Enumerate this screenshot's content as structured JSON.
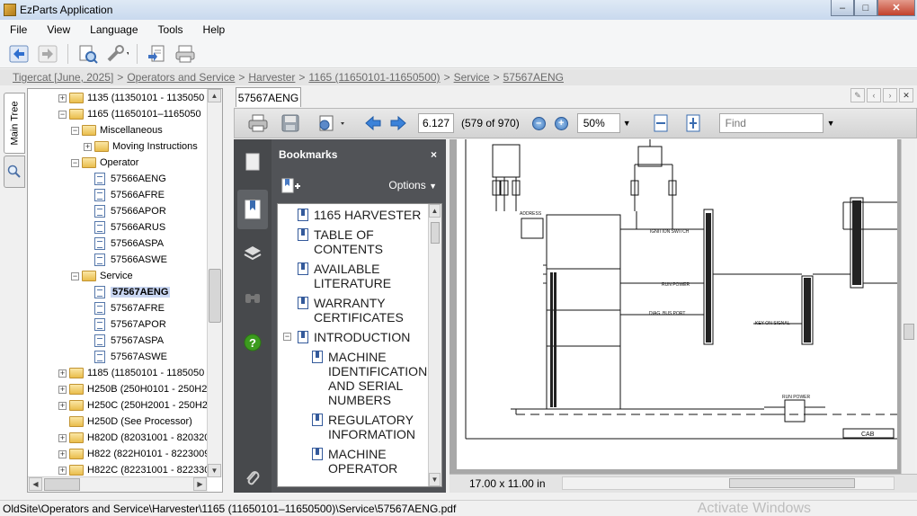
{
  "window": {
    "title": "EzParts Application"
  },
  "menu": [
    "File",
    "View",
    "Language",
    "Tools",
    "Help"
  ],
  "breadcrumb": [
    "Tigercat [June, 2025]",
    "Operators and Service",
    "Harvester",
    "1165 (11650101-11650500)",
    "Service",
    "57567AENG"
  ],
  "side_tabs": {
    "main_tree": "Main Tree"
  },
  "tree": {
    "items": [
      {
        "label": "1135 (11350101 - 1135050",
        "type": "folder",
        "state": "expand"
      },
      {
        "label": "1165 (11650101–1165050",
        "type": "folder",
        "state": "collapse"
      },
      {
        "label": "Miscellaneous",
        "type": "folder",
        "state": "collapse"
      },
      {
        "label": "Moving Instructions",
        "type": "folder",
        "state": "expand"
      },
      {
        "label": "Operator",
        "type": "folder",
        "state": "collapse"
      },
      {
        "label": "57566AENG",
        "type": "doc"
      },
      {
        "label": "57566AFRE",
        "type": "doc"
      },
      {
        "label": "57566APOR",
        "type": "doc"
      },
      {
        "label": "57566ARUS",
        "type": "doc"
      },
      {
        "label": "57566ASPA",
        "type": "doc"
      },
      {
        "label": "57566ASWE",
        "type": "doc"
      },
      {
        "label": "Service",
        "type": "folder",
        "state": "collapse"
      },
      {
        "label": "57567AENG",
        "type": "doc",
        "selected": true
      },
      {
        "label": "57567AFRE",
        "type": "doc"
      },
      {
        "label": "57567APOR",
        "type": "doc"
      },
      {
        "label": "57567ASPA",
        "type": "doc"
      },
      {
        "label": "57567ASWE",
        "type": "doc"
      },
      {
        "label": "1185 (11850101 - 1185050",
        "type": "folder",
        "state": "expand"
      },
      {
        "label": "H250B (250H0101 - 250H20",
        "type": "folder",
        "state": "expand"
      },
      {
        "label": "H250C (250H2001 - 250H22",
        "type": "folder",
        "state": "expand"
      },
      {
        "label": "H250D (See Processor)",
        "type": "folder"
      },
      {
        "label": "H820D (82031001 - 820320",
        "type": "folder",
        "state": "expand"
      },
      {
        "label": "H822 (822H0101 - 8223009",
        "type": "folder",
        "state": "expand"
      },
      {
        "label": "H822C (82231001 - 822330",
        "type": "folder",
        "state": "expand"
      }
    ]
  },
  "document_tab": {
    "label": "57567AENG"
  },
  "pdf_toolbar": {
    "page_value": "6.127",
    "page_of": "(579 of 970)",
    "zoom": "50%",
    "find_placeholder": "Find"
  },
  "bookmarks": {
    "header": "Bookmarks",
    "close": "×",
    "options": "Options",
    "items": [
      {
        "label": "1165 HARVESTER",
        "level": 0
      },
      {
        "label": "TABLE OF CONTENTS",
        "level": 0
      },
      {
        "label": "AVAILABLE LITERATURE",
        "level": 0
      },
      {
        "label": "WARRANTY CERTIFICATES",
        "level": 0
      },
      {
        "label": "INTRODUCTION",
        "level": 0,
        "expanded": true
      },
      {
        "label": "MACHINE IDENTIFICATION AND SERIAL NUMBERS",
        "level": 1
      },
      {
        "label": "REGULATORY INFORMATION",
        "level": 1
      },
      {
        "label": "MACHINE OPERATOR",
        "level": 1
      }
    ]
  },
  "drawing_labels": {
    "ignition": "IGNITION SWITCH",
    "run_power": "RUN POWER",
    "diag_bus": "DIAG. BUS PORT",
    "key_on": "KEY ON SIGNAL",
    "cab": "CAB",
    "run_power2": "RUN POWER",
    "address": "ADDRESS"
  },
  "pdf_status": {
    "page_size": "17.00 x 11.00 in"
  },
  "status": {
    "path": "OldSite\\Operators and Service\\Harvester\\1165 (11650101–11650500)\\Service\\57567AENG.pdf",
    "watermark": "Activate Windows"
  },
  "colors": {
    "sidenav": "#47494c",
    "bookmark_panel": "#515357",
    "selection": "#c9d6f2",
    "help_icon": "#3c9b1e"
  }
}
